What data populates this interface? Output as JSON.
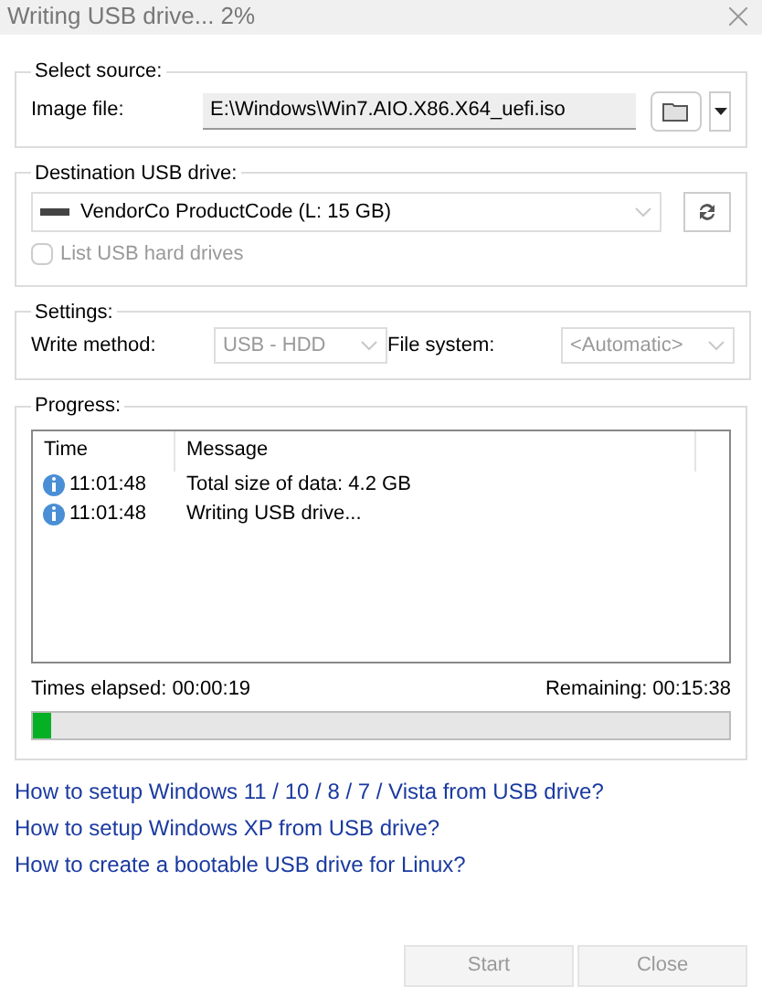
{
  "window": {
    "title": "Writing USB drive... 2%"
  },
  "source": {
    "legend": "Select source:",
    "label": "Image file:",
    "value": "E:\\Windows\\Win7.AIO.X86.X64_uefi.iso"
  },
  "destination": {
    "legend": "Destination USB drive:",
    "drive": "VendorCo ProductCode (L:  15 GB)",
    "checkbox": {
      "label": "List USB hard drives",
      "checked": false,
      "disabled": true
    }
  },
  "settings": {
    "legend": "Settings:",
    "fields": [
      {
        "label": "Write method:",
        "value": "USB - HDD",
        "disabled": true
      },
      {
        "label": "File system:",
        "value": "<Automatic>",
        "disabled": true
      }
    ]
  },
  "progress": {
    "legend": "Progress:",
    "columns": [
      "Time",
      "Message"
    ],
    "rows": [
      {
        "time": "11:01:48",
        "message": "Total size of data: 4.2 GB"
      },
      {
        "time": "11:01:48",
        "message": "Writing USB drive..."
      }
    ],
    "elapsed": "Times elapsed:  00:00:19",
    "remaining": "Remaining:  00:15:38",
    "level": 0.025
  },
  "links": [
    "How to setup Windows 11 / 10 / 8 / 7 / Vista from USB drive?",
    "How to setup Windows XP from USB drive?",
    "How to create a bootable USB drive for Linux?"
  ],
  "buttons": [
    {
      "label": "Start",
      "disabled": true
    },
    {
      "label": "Close",
      "disabled": true
    }
  ]
}
